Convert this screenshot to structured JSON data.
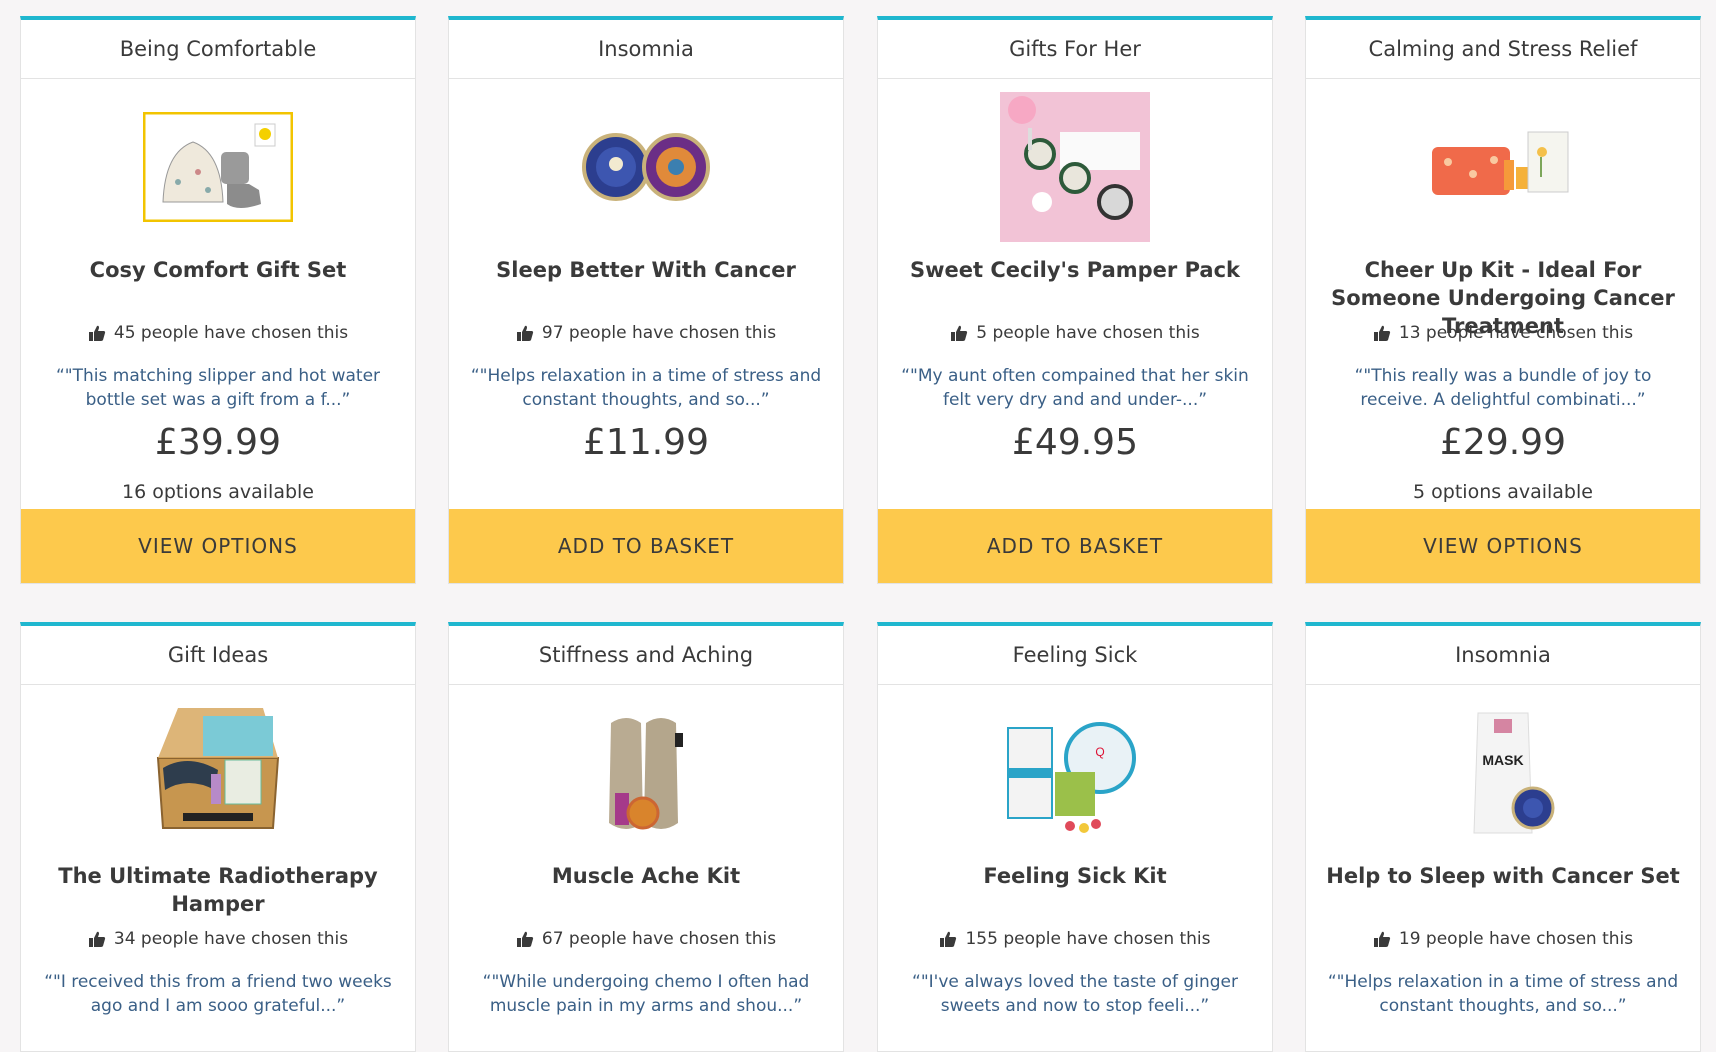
{
  "accent": "#1fb7cf",
  "cta_color": "#fdc94c",
  "quote_color": "#3a5f86",
  "cards": [
    {
      "category": "Being Comfortable",
      "name": "Cosy Comfort Gift Set",
      "likes": "45 people have chosen this",
      "quote": "“\"This matching slipper and hot water bottle set was a gift from a f...”",
      "price": "£39.99",
      "options": "16 options available",
      "cta": "VIEW OPTIONS",
      "image": "slipper-and-hot-water-bottle"
    },
    {
      "category": "Insomnia",
      "name": "Sleep Better With Cancer",
      "likes": "97 people have chosen this",
      "quote": "“\"Helps relaxation in a time of stress and constant thoughts, and so...”",
      "price": "£11.99",
      "options": "",
      "cta": "ADD TO BASKET",
      "image": "badger-sleep-balm-tins"
    },
    {
      "category": "Gifts For Her",
      "name": "Sweet Cecily's Pamper Pack",
      "likes": "5 people have chosen this",
      "quote": "“\"My aunt often compained that her skin felt very dry and and under-...”",
      "price": "£49.95",
      "options": "",
      "cta": "ADD TO BASKET",
      "image": "pamper-pack-box"
    },
    {
      "category": "Calming and Stress Relief",
      "name": "Cheer Up Kit - Ideal For Someone Undergoing Cancer Treatment",
      "likes": "13 people have chosen this",
      "quote": "“\"This really was a bundle of joy to receive. A delightful combinati...”",
      "price": "£29.99",
      "options": "5 options available",
      "cta": "VIEW OPTIONS",
      "image": "cheer-up-kit"
    },
    {
      "category": "Gift Ideas",
      "name": "The Ultimate Radiotherapy Hamper",
      "likes": "34 people have chosen this",
      "quote": "“\"I received this from a friend two weeks ago and I am sooo grateful...”",
      "price": "",
      "options": "",
      "cta": "",
      "image": "wicker-hamper"
    },
    {
      "category": "Stiffness and Aching",
      "name": "Muscle Ache Kit",
      "likes": "67 people have chosen this",
      "quote": "“\"While undergoing chemo I often had muscle pain in my arms and shou...”",
      "price": "",
      "options": "",
      "cta": "",
      "image": "wheat-heat-pack"
    },
    {
      "category": "Feeling Sick",
      "name": "Feeling Sick Kit",
      "likes": "155 people have chosen this",
      "quote": "“\"I've always loved the taste of ginger sweets and now to stop feeli...”",
      "price": "",
      "options": "",
      "cta": "",
      "image": "sea-band-and-ginger-sweets"
    },
    {
      "category": "Insomnia",
      "name": "Help to Sleep with Cancer Set",
      "likes": "19 people have chosen this",
      "quote": "“\"Helps relaxation in a time of stress and constant thoughts, and so...”",
      "price": "",
      "options": "",
      "cta": "",
      "image": "sleep-mask-and-balm"
    }
  ]
}
